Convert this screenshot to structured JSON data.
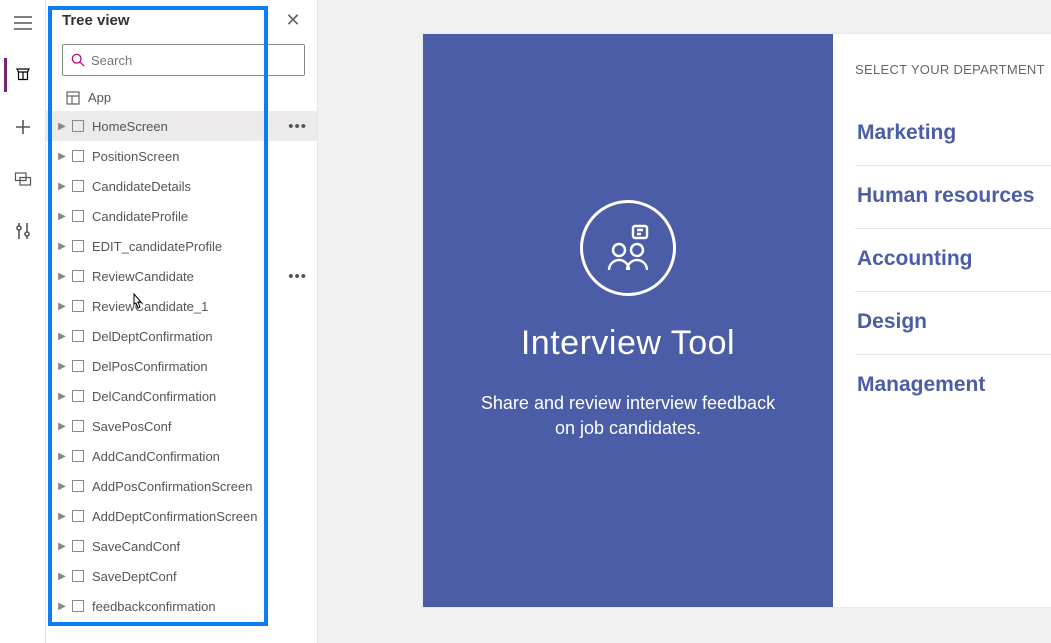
{
  "leftRail": {
    "items": [
      "hamburger",
      "tree",
      "insert",
      "media",
      "advanced"
    ]
  },
  "treePane": {
    "title": "Tree view",
    "search_placeholder": "Search",
    "app_label": "App",
    "items": [
      {
        "label": "HomeScreen",
        "selected": true,
        "showMore": true
      },
      {
        "label": "PositionScreen"
      },
      {
        "label": "CandidateDetails"
      },
      {
        "label": "CandidateProfile"
      },
      {
        "label": "EDIT_candidateProfile"
      },
      {
        "label": "ReviewCandidate",
        "showMore": true
      },
      {
        "label": "ReviewCandidate_1"
      },
      {
        "label": "DelDeptConfirmation"
      },
      {
        "label": "DelPosConfirmation"
      },
      {
        "label": "DelCandConfirmation"
      },
      {
        "label": "SavePosConf"
      },
      {
        "label": "AddCandConfirmation"
      },
      {
        "label": "AddPosConfirmationScreen"
      },
      {
        "label": "AddDeptConfirmationScreen"
      },
      {
        "label": "SaveCandConf"
      },
      {
        "label": "SaveDeptConf"
      },
      {
        "label": "feedbackconfirmation"
      }
    ]
  },
  "preview": {
    "title": "Interview Tool",
    "subtitle": "Share and review interview feedback on job candidates.",
    "dept_heading": "SELECT YOUR DEPARTMENT",
    "departments": [
      "Marketing",
      "Human resources",
      "Accounting",
      "Design",
      "Management"
    ]
  }
}
